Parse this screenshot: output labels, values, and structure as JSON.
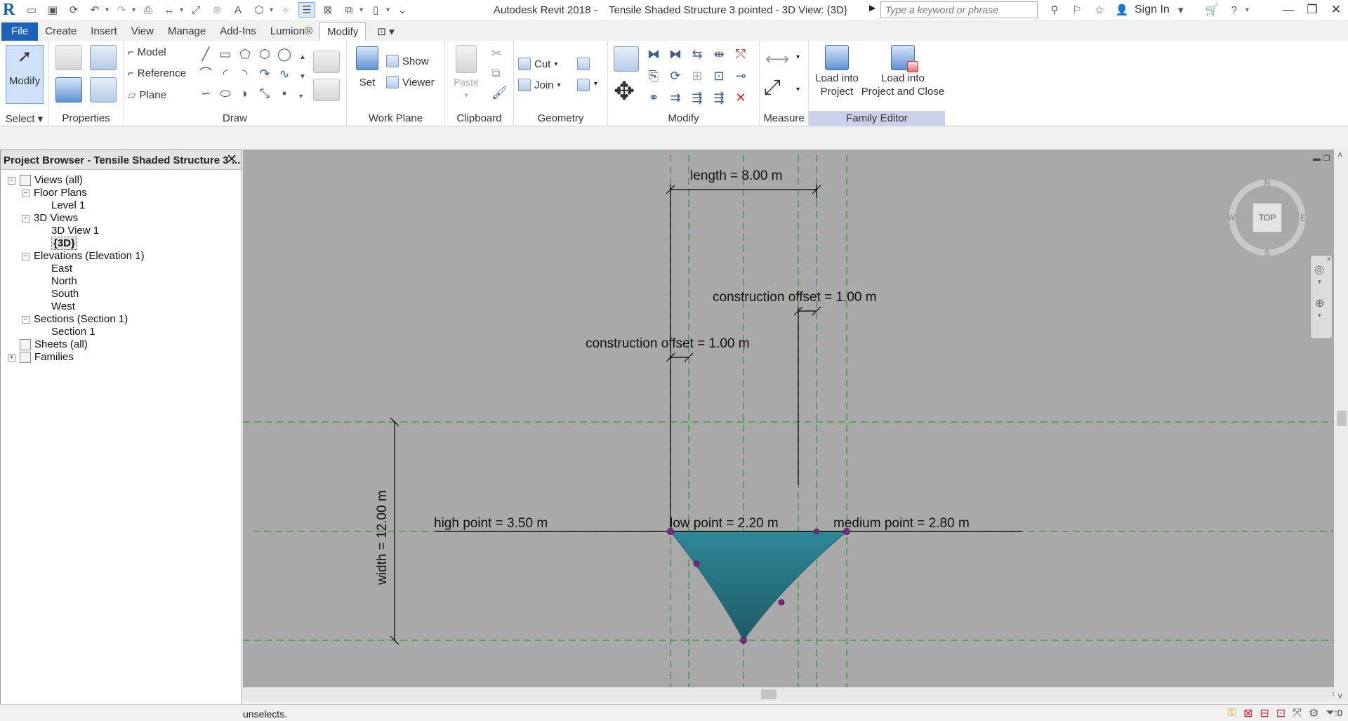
{
  "app": {
    "title": "Autodesk Revit 2018 -    Tensile Shaded Structure 3 pointed - 3D View: {3D}",
    "search_placeholder": "Type a keyword or phrase",
    "sign_in": "Sign In"
  },
  "qat": {
    "icons": [
      "revit-logo",
      "open-icon",
      "save-icon",
      "sync-icon",
      "undo-icon",
      "redo-icon",
      "print-icon",
      "measure-icon",
      "dimension-icon",
      "tag-icon",
      "text-icon",
      "3d-view-icon",
      "section-icon",
      "thin-lines-icon",
      "close-hidden-icon",
      "switch-windows-icon",
      "ui-icon"
    ]
  },
  "tabs": [
    "File",
    "Create",
    "Insert",
    "View",
    "Manage",
    "Add-Ins",
    "Lumion®",
    "Modify"
  ],
  "active_tab": "Modify",
  "ribbon": {
    "select": {
      "button": "Modify",
      "panel": "Select"
    },
    "properties": {
      "panel": "Properties"
    },
    "draw": {
      "model": "Model",
      "reference": "Reference",
      "plane": "Plane",
      "panel": "Draw"
    },
    "work_plane": {
      "set": "Set",
      "show": "Show",
      "viewer": "Viewer",
      "panel": "Work Plane"
    },
    "clipboard": {
      "paste": "Paste",
      "panel": "Clipboard"
    },
    "geometry": {
      "cut": "Cut",
      "join": "Join",
      "panel": "Geometry"
    },
    "modify": {
      "panel": "Modify"
    },
    "measure": {
      "panel": "Measure"
    },
    "family_editor": {
      "load": "Load into\nProject",
      "load_close": "Load into\nProject and Close",
      "panel": "Family Editor"
    }
  },
  "browser": {
    "title": "Project Browser - Tensile Shaded Structure 3 ...",
    "nodes": [
      {
        "label": "Views (all)",
        "toggle": "−",
        "level": 0
      },
      {
        "label": "Floor Plans",
        "toggle": "−",
        "level": 1
      },
      {
        "label": "Level 1",
        "toggle": "",
        "level": 2
      },
      {
        "label": "3D Views",
        "toggle": "−",
        "level": 1
      },
      {
        "label": "3D View 1",
        "toggle": "",
        "level": 2
      },
      {
        "label": "{3D}",
        "toggle": "",
        "level": 2,
        "selected": true
      },
      {
        "label": "Elevations (Elevation 1)",
        "toggle": "−",
        "level": 1
      },
      {
        "label": "East",
        "toggle": "",
        "level": 2
      },
      {
        "label": "North",
        "toggle": "",
        "level": 2
      },
      {
        "label": "South",
        "toggle": "",
        "level": 2
      },
      {
        "label": "West",
        "toggle": "",
        "level": 2
      },
      {
        "label": "Sections (Section 1)",
        "toggle": "−",
        "level": 1
      },
      {
        "label": "Section 1",
        "toggle": "",
        "level": 2
      },
      {
        "label": "Sheets (all)",
        "toggle": "",
        "level": 0
      },
      {
        "label": "Families",
        "toggle": "+",
        "level": 0
      }
    ]
  },
  "viewport": {
    "dims": {
      "length": "length = 8.00 m",
      "offset_top": "construction offset = 1.00 m",
      "offset_left": "construction offset = 1.00 m",
      "width": "width = 12.00 m",
      "high_point": "high point = 3.50 m",
      "low_point": "low point = 2.20 m",
      "medium_point": "medium point = 2.80 m"
    },
    "viewcube": {
      "face": "TOP",
      "n": "N",
      "s": "S",
      "e": "E",
      "w": "W"
    },
    "shape_color": "#2e8897",
    "ref_line_color": "#2f9a2f"
  },
  "status": {
    "text": "unselects.",
    "filter_count": ":0"
  }
}
